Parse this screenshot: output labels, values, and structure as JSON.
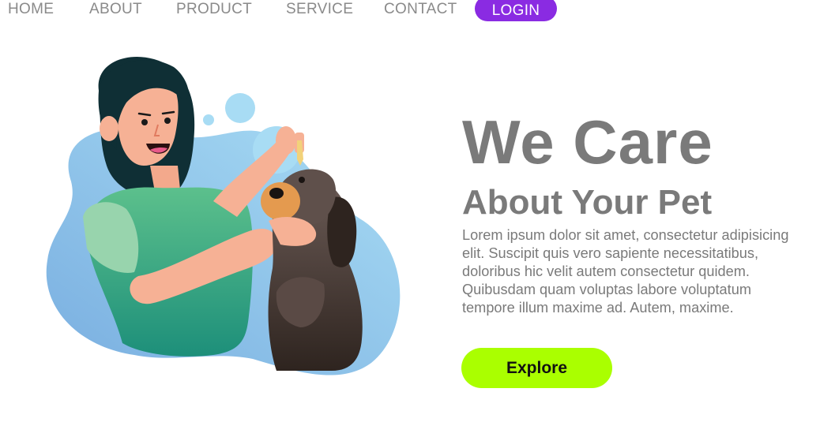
{
  "nav": {
    "home": "HOME",
    "about": "ABOUT",
    "product": "PRODUCT",
    "service": "SERVICE",
    "contact": "CONTACT",
    "login": "LOGIN"
  },
  "hero": {
    "title": "We Care",
    "subtitle": "About Your Pet",
    "body": "Lorem ipsum dolor sit amet, consectetur adipisicing elit. Suscipit quis vero sapiente necessitatibus, doloribus hic velit autem consectetur quidem. Quibusdam quam voluptas labore voluptatum tempore illum maxime ad. Autem, maxime.",
    "explore_label": "Explore"
  },
  "colors": {
    "login_bg": "#8a2be2",
    "explore_bg": "#aaff00",
    "text_gray": "#7a7a7a",
    "blob_blue": "#8cc8ec"
  }
}
